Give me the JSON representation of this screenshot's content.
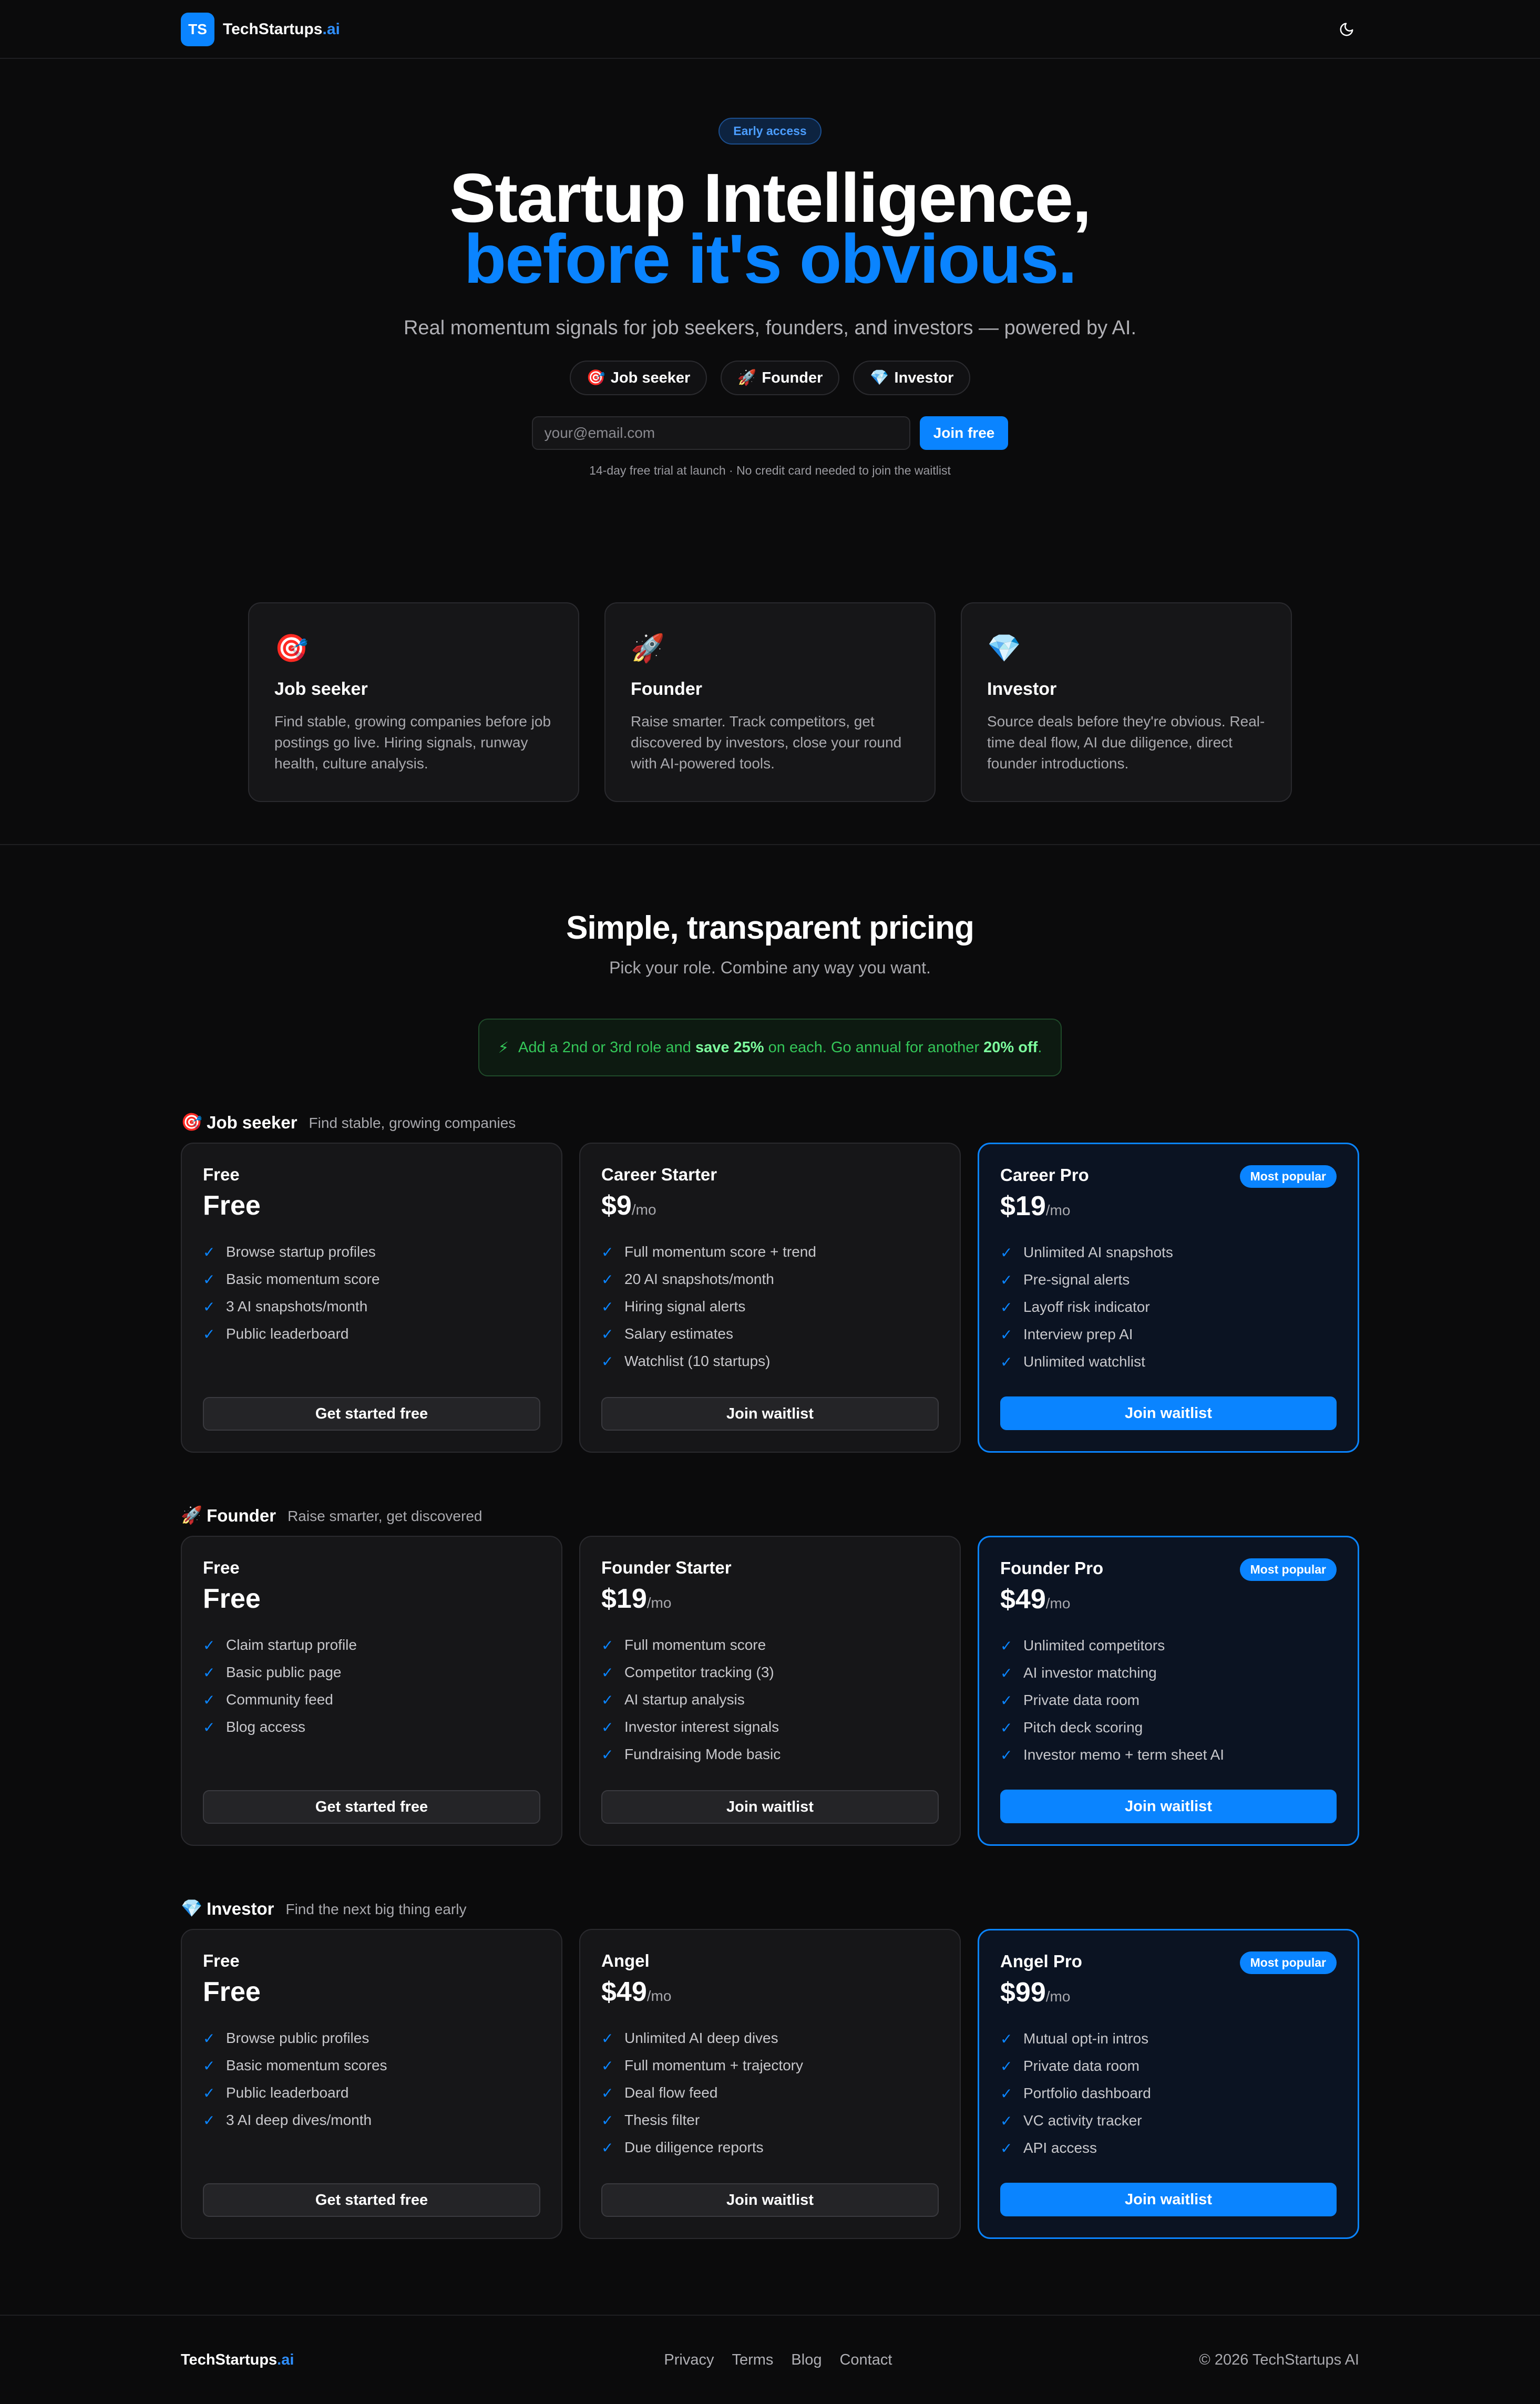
{
  "nav": {
    "logo_initials": "TS",
    "brand_main": "TechStartups",
    "brand_accent": ".ai",
    "theme_icon": "moon-icon"
  },
  "hero": {
    "pill": "Early access",
    "headline_line1": "Startup Intelligence,",
    "headline_line2": "before it's obvious.",
    "subhead": "Real momentum signals for job seekers, founders, and investors — powered by AI.",
    "roles": [
      {
        "emoji": "🎯",
        "label": "Job seeker"
      },
      {
        "emoji": "🚀",
        "label": "Founder"
      },
      {
        "emoji": "💎",
        "label": "Investor"
      }
    ],
    "email_placeholder": "your@email.com",
    "join_label": "Join free",
    "fineprint": "14-day free trial at launch · No credit card needed to join the waitlist"
  },
  "role_cards": [
    {
      "emoji": "🎯",
      "title": "Job seeker",
      "desc": "Find stable, growing companies before job postings go live. Hiring signals, runway health, culture analysis."
    },
    {
      "emoji": "🚀",
      "title": "Founder",
      "desc": "Raise smarter. Track competitors, get discovered by investors, close your round with AI-powered tools."
    },
    {
      "emoji": "💎",
      "title": "Investor",
      "desc": "Source deals before they're obvious. Real-time deal flow, AI due diligence, direct founder introductions."
    }
  ],
  "pricing": {
    "title": "Simple, transparent pricing",
    "subtitle": "Pick your role. Combine any way you want.",
    "promo": {
      "icon": "⚡",
      "text_a": "Add a 2nd or 3rd role and",
      "bold_a": "save 25%",
      "text_b": "on each. Go annual for another",
      "bold_b": "20% off",
      "text_c": "."
    },
    "badge": "Most popular",
    "per": "/mo",
    "groups": [
      {
        "emoji": "🎯",
        "name": "Job seeker",
        "desc": "Find stable, growing companies",
        "tiers": [
          {
            "name": "Free",
            "price": "Free",
            "per": "",
            "features": [
              "Browse startup profiles",
              "Basic momentum score",
              "3 AI snapshots/month",
              "Public leaderboard"
            ],
            "cta": "Get started free"
          },
          {
            "name": "Career Starter",
            "price": "$9",
            "per": "/mo",
            "features": [
              "Full momentum score + trend",
              "20 AI snapshots/month",
              "Hiring signal alerts",
              "Salary estimates",
              "Watchlist (10 startups)"
            ],
            "cta": "Join waitlist"
          },
          {
            "name": "Career Pro",
            "price": "$19",
            "per": "/mo",
            "features": [
              "Unlimited AI snapshots",
              "Pre-signal alerts",
              "Layoff risk indicator",
              "Interview prep AI",
              "Unlimited watchlist"
            ],
            "cta": "Join waitlist"
          }
        ]
      },
      {
        "emoji": "🚀",
        "name": "Founder",
        "desc": "Raise smarter, get discovered",
        "tiers": [
          {
            "name": "Free",
            "price": "Free",
            "per": "",
            "features": [
              "Claim startup profile",
              "Basic public page",
              "Community feed",
              "Blog access"
            ],
            "cta": "Get started free"
          },
          {
            "name": "Founder Starter",
            "price": "$19",
            "per": "/mo",
            "features": [
              "Full momentum score",
              "Competitor tracking (3)",
              "AI startup analysis",
              "Investor interest signals",
              "Fundraising Mode basic"
            ],
            "cta": "Join waitlist"
          },
          {
            "name": "Founder Pro",
            "price": "$49",
            "per": "/mo",
            "features": [
              "Unlimited competitors",
              "AI investor matching",
              "Private data room",
              "Pitch deck scoring",
              "Investor memo + term sheet AI"
            ],
            "cta": "Join waitlist"
          }
        ]
      },
      {
        "emoji": "💎",
        "name": "Investor",
        "desc": "Find the next big thing early",
        "tiers": [
          {
            "name": "Free",
            "price": "Free",
            "per": "",
            "features": [
              "Browse public profiles",
              "Basic momentum scores",
              "Public leaderboard",
              "3 AI deep dives/month"
            ],
            "cta": "Get started free"
          },
          {
            "name": "Angel",
            "price": "$49",
            "per": "/mo",
            "features": [
              "Unlimited AI deep dives",
              "Full momentum + trajectory",
              "Deal flow feed",
              "Thesis filter",
              "Due diligence reports"
            ],
            "cta": "Join waitlist"
          },
          {
            "name": "Angel Pro",
            "price": "$99",
            "per": "/mo",
            "features": [
              "Mutual opt-in intros",
              "Private data room",
              "Portfolio dashboard",
              "VC activity tracker",
              "API access"
            ],
            "cta": "Join waitlist"
          }
        ]
      }
    ]
  },
  "footer": {
    "brand_main": "TechStartups",
    "brand_accent": ".ai",
    "links": [
      "Privacy",
      "Terms",
      "Blog",
      "Contact"
    ],
    "copyright": "© 2026 TechStartups AI"
  },
  "colors": {
    "background": "#0b0b0c",
    "accent": "#0a84ff",
    "promo_green": "#34c759"
  }
}
